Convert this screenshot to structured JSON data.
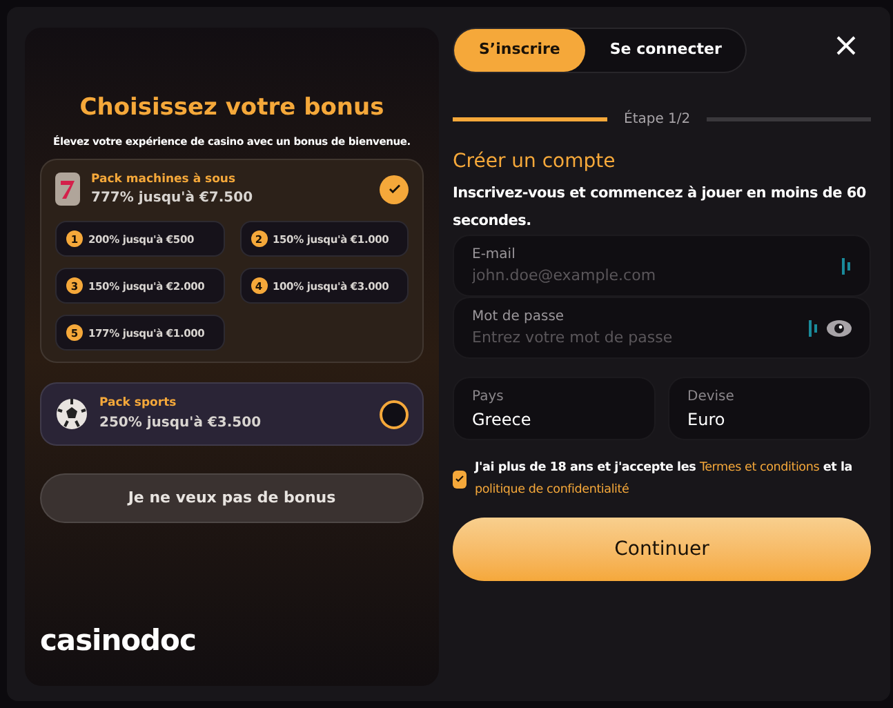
{
  "bonus_panel": {
    "title": "Choisissez votre bonus",
    "subtitle": "Élevez votre expérience de casino avec un bonus de bienvenue.",
    "packs": [
      {
        "kind": "slots",
        "name": "Pack machines à sous",
        "offer": "777% jusqu'à €7.500",
        "selected": true,
        "options": [
          {
            "number": "1",
            "text": "200% jusqu'à €500"
          },
          {
            "number": "2",
            "text": "150% jusqu'à €1.000"
          },
          {
            "number": "3",
            "text": "150% jusqu'à €2.000"
          },
          {
            "number": "4",
            "text": "100% jusqu'à €3.000"
          },
          {
            "number": "5",
            "text": "177% jusqu'à €1.000"
          }
        ]
      },
      {
        "kind": "sports",
        "name": "Pack sports",
        "offer": "250% jusqu'à €3.500",
        "selected": false
      }
    ],
    "no_bonus_button": "Je ne veux pas de bonus",
    "logo": "casinodoc"
  },
  "form": {
    "tabs": [
      {
        "label": "S’inscrire",
        "selected": true
      },
      {
        "label": "Se connecter",
        "selected": false
      }
    ],
    "step": {
      "label": "Étape 1/2",
      "level": 0.37
    },
    "heading": "Créer un compte",
    "description": "Inscrivez-vous et commencez à jouer en moins de 60 secondes.",
    "fields": [
      {
        "kind": "email",
        "label": "E-mail",
        "placeholder": "john.doe@example.com"
      },
      {
        "kind": "password",
        "label": "Mot de passe",
        "placeholder": "Entrez votre mot de passe"
      }
    ],
    "selects": [
      {
        "label": "Pays",
        "value": "Greece"
      },
      {
        "label": "Devise",
        "value": "Euro"
      }
    ],
    "consent": {
      "checked": true,
      "parts": [
        {
          "kind": "text",
          "text": "J'ai plus de 18 ans et j'accepte les "
        },
        {
          "kind": "link",
          "text": "Termes et conditions"
        },
        {
          "kind": "text",
          "text": " et la "
        },
        {
          "kind": "link",
          "text": "politique de confidentialité"
        }
      ]
    },
    "submit": "Continuer"
  }
}
